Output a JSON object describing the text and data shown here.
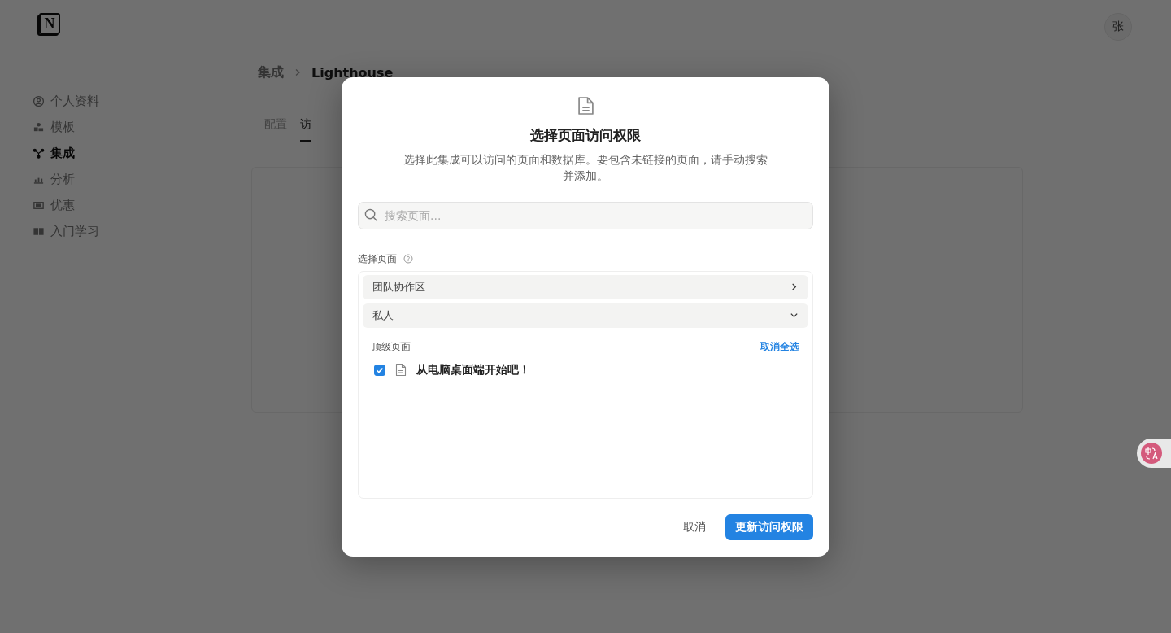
{
  "logo": {
    "letter": "N"
  },
  "avatar": {
    "initial": "张"
  },
  "sidebar": {
    "items": [
      {
        "label": "个人资料",
        "kind": "profile",
        "selected": false
      },
      {
        "label": "模板",
        "kind": "templates",
        "selected": false
      },
      {
        "label": "集成",
        "kind": "integrations",
        "selected": true
      },
      {
        "label": "分析",
        "kind": "analytics",
        "selected": false
      },
      {
        "label": "优惠",
        "kind": "offers",
        "selected": false
      },
      {
        "label": "入门学习",
        "kind": "learn",
        "selected": false
      }
    ]
  },
  "breadcrumb": [
    "集成",
    "Lighthouse"
  ],
  "tabs": [
    {
      "label": "配置",
      "selected": false
    },
    {
      "label": "访",
      "selected": true
    }
  ],
  "dialog": {
    "title": "选择页面访问权限",
    "description": "选择此集成可以访问的页面和数据库。要包含未链接的页面，请手动搜索并添加。",
    "search": {
      "placeholder": "搜索页面..."
    },
    "section_label": "选择页面",
    "groups": [
      {
        "label": "团队协作区",
        "expanded": false
      },
      {
        "label": "私人",
        "expanded": true,
        "subheader": "顶级页面",
        "action": "取消全选",
        "pages": [
          {
            "title": "从电脑桌面端开始吧！",
            "checked": true
          }
        ]
      }
    ],
    "cancel": "取消",
    "confirm": "更新访问权限"
  }
}
